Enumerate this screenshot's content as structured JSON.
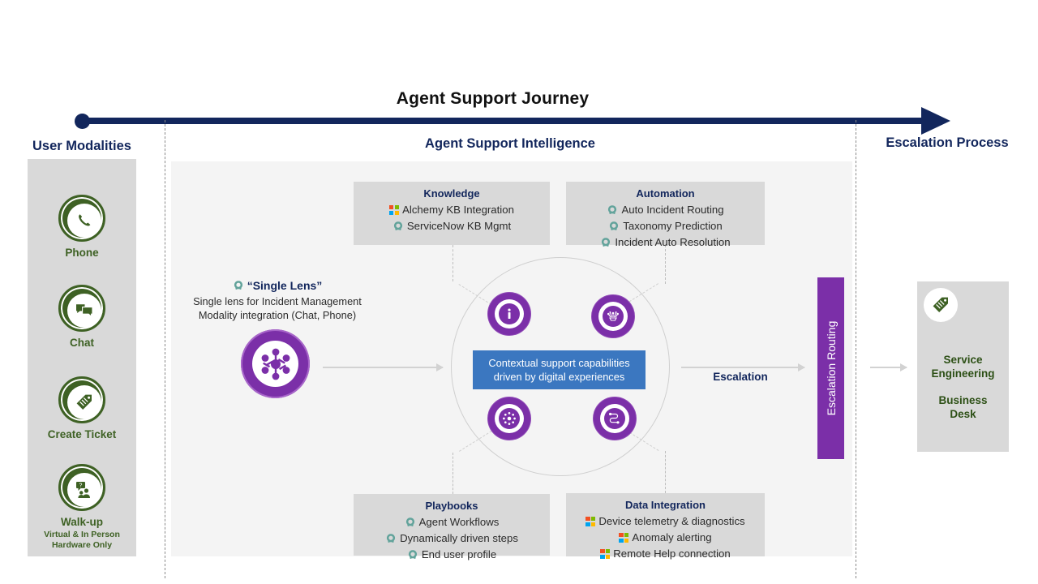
{
  "journey": {
    "title": "Agent Support Journey"
  },
  "columns": {
    "left_heading": "User Modalities",
    "center_heading": "Agent Support Intelligence",
    "right_heading": "Escalation Process"
  },
  "modalities": [
    {
      "icon": "phone-icon",
      "label": "Phone",
      "sublabel": ""
    },
    {
      "icon": "chat-icon",
      "label": "Chat",
      "sublabel": ""
    },
    {
      "icon": "ticket-tag-icon",
      "label": "Create Ticket",
      "sublabel": ""
    },
    {
      "icon": "walk-up-people-icon",
      "label": "Walk-up",
      "sublabel": "Virtual & In Person\nHardware Only",
      "sublabel_line1": "Virtual & In Person",
      "sublabel_line2": "Hardware Only"
    }
  ],
  "cards": {
    "knowledge": {
      "title": "Knowledge",
      "items": [
        {
          "icon": "microsoft-logo-icon",
          "text": "Alchemy KB Integration"
        },
        {
          "icon": "servicenow-logo-icon",
          "text": "ServiceNow KB Mgmt"
        }
      ]
    },
    "automation": {
      "title": "Automation",
      "items": [
        {
          "icon": "servicenow-logo-icon",
          "text": "Auto Incident Routing"
        },
        {
          "icon": "servicenow-logo-icon",
          "text": "Taxonomy Prediction"
        },
        {
          "icon": "servicenow-logo-icon",
          "text": "Incident Auto Resolution"
        }
      ]
    },
    "playbooks": {
      "title": "Playbooks",
      "items": [
        {
          "icon": "servicenow-logo-icon",
          "text": "Agent Workflows"
        },
        {
          "icon": "servicenow-logo-icon",
          "text": "Dynamically driven steps"
        },
        {
          "icon": "servicenow-logo-icon",
          "text": "End user profile"
        }
      ]
    },
    "data_integration": {
      "title": "Data Integration",
      "items": [
        {
          "icon": "microsoft-logo-icon",
          "text": "Device telemetry & diagnostics"
        },
        {
          "icon": "microsoft-logo-icon",
          "text": "Anomaly alerting"
        },
        {
          "icon": "microsoft-logo-icon",
          "text": "Remote Help connection"
        }
      ]
    }
  },
  "single_lens": {
    "icon": "servicenow-logo-icon",
    "title": "“Single Lens”",
    "sub_line1": "Single lens for Incident Management",
    "sub_line2": "Modality integration (Chat, Phone)",
    "orb_icon": "hub-network-icon"
  },
  "center": {
    "banner_line1": "Contextual support capabilities",
    "banner_line2": "driven by digital experiences",
    "orbs": [
      {
        "icon": "info-circle-icon"
      },
      {
        "icon": "ai-brain-network-icon"
      },
      {
        "icon": "cycle-dots-icon"
      },
      {
        "icon": "flow-path-icon"
      }
    ]
  },
  "escalation": {
    "arrow_label": "Escalation",
    "routing_bar_label": "Escalation Routing"
  },
  "destination": {
    "icon": "ticket-tag-icon",
    "label_line1": "Service",
    "label_line2": "Engineering",
    "label2_line1": "Business",
    "label2_line2": "Desk"
  },
  "colors": {
    "navy": "#12265c",
    "purple": "#7b2fa8",
    "green": "#3e6124",
    "blue_banner": "#3b77c0",
    "card_grey": "#d9d9d9",
    "panel_grey": "#f4f4f4"
  }
}
